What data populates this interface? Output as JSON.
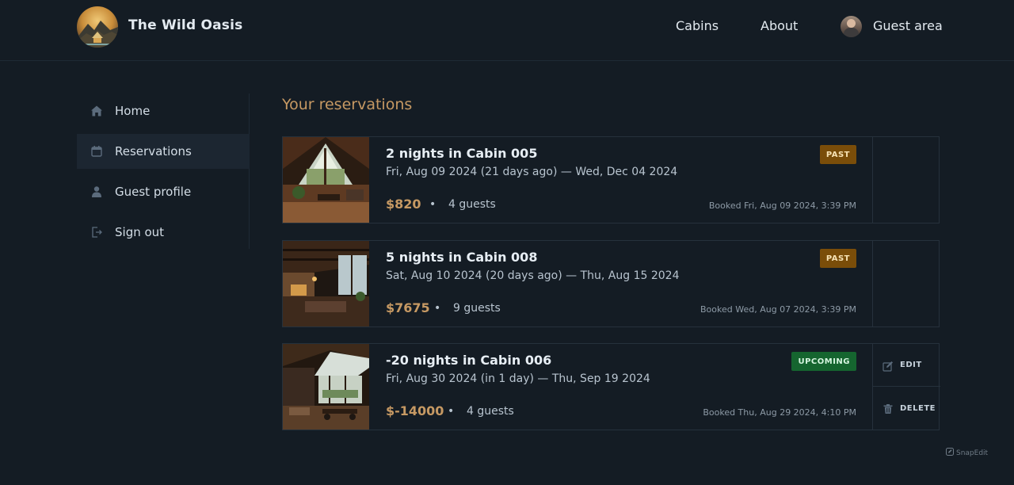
{
  "header": {
    "brand": "The Wild Oasis",
    "nav": [
      "Cabins",
      "About",
      "Guest area"
    ]
  },
  "sidebar": {
    "items": [
      {
        "label": "Home",
        "icon": "home-icon",
        "active": false
      },
      {
        "label": "Reservations",
        "icon": "calendar-icon",
        "active": true
      },
      {
        "label": "Guest profile",
        "icon": "user-icon",
        "active": false
      },
      {
        "label": "Sign out",
        "icon": "sign-out-icon",
        "active": false
      }
    ]
  },
  "main": {
    "title": "Your reservations",
    "reservations": [
      {
        "title": "2 nights in Cabin 005",
        "dates": "Fri, Aug 09 2024 (21 days ago) — Wed, Dec 04 2024",
        "price": "$820",
        "separator": "•",
        "guests": "4 guests",
        "booked": "Booked Fri, Aug 09 2024, 3:39 PM",
        "status": "PAST",
        "has_actions": false
      },
      {
        "title": "5 nights in Cabin 008",
        "dates": "Sat, Aug 10 2024 (20 days ago) — Thu, Aug 15 2024",
        "price": "$7675",
        "separator": "•",
        "guests": "9 guests",
        "booked": "Booked Wed, Aug 07 2024, 3:39 PM",
        "status": "PAST",
        "has_actions": false
      },
      {
        "title": "-20 nights in Cabin 006",
        "dates": "Fri, Aug 30 2024 (in 1 day) — Thu, Sep 19 2024",
        "price": "$-14000",
        "separator": "•",
        "guests": "4 guests",
        "booked": "Booked Thu, Aug 29 2024, 4:10 PM",
        "status": "UPCOMING",
        "has_actions": true,
        "edit_label": "EDIT",
        "delete_label": "DELETE"
      }
    ]
  },
  "watermark": "SnapEdit",
  "colors": {
    "background": "#141c24",
    "accent": "#c69963",
    "past_badge": "#7a4d09",
    "upcoming_badge": "#15652f"
  }
}
